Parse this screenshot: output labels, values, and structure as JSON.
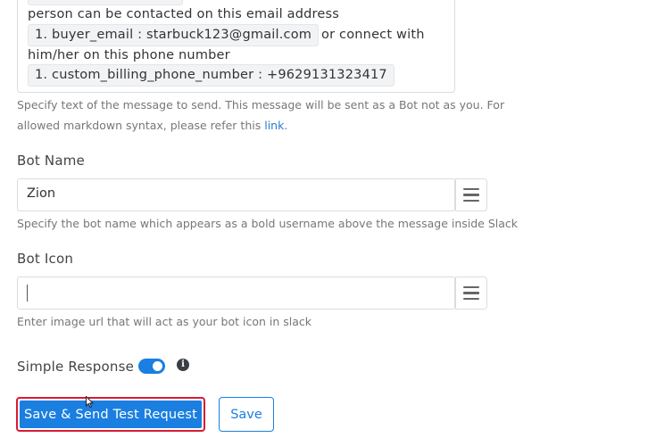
{
  "message": {
    "line1": "person can be contacted on this email address",
    "email_pill": "1. buyer_email : starbuck123@gmail.com",
    "line2_suffix": "or connect with",
    "line3": "him/her on this phone number",
    "phone_pill": "1. custom_billing_phone_number : +9629131323417",
    "help_text": "Specify text of the message to send. This message will be sent as a Bot not as you. For",
    "help_text_2": "allowed markdown syntax, please refer this",
    "help_link": "link",
    "help_text_end": "."
  },
  "bot_name": {
    "label": "Bot Name",
    "value": "Zion",
    "help": "Specify the bot name which appears as a bold username above the message inside Slack"
  },
  "bot_icon": {
    "label": "Bot Icon",
    "value": "",
    "help": "Enter image url that will act as your bot icon in slack"
  },
  "simple_response": {
    "label": "Simple Response",
    "enabled": true
  },
  "actions": {
    "primary_label": "Save & Send Test Request",
    "secondary_label": "Save"
  },
  "colors": {
    "accent": "#1a7fe0",
    "highlight_border": "#d81b35",
    "link": "#2a7ad1"
  }
}
